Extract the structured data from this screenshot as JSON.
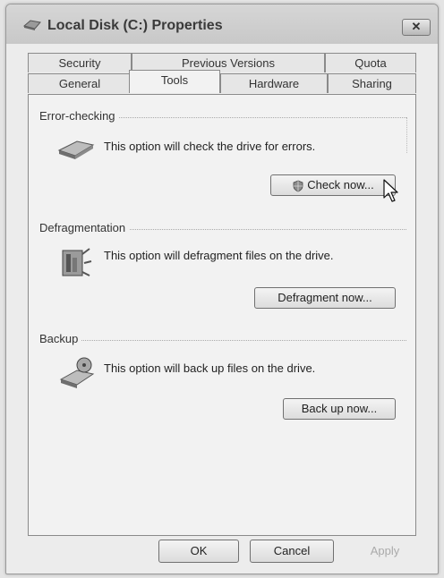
{
  "window": {
    "title": "Local Disk (C:) Properties",
    "close_label": "✕"
  },
  "tabs": {
    "row1": [
      {
        "label": "Security"
      },
      {
        "label": "Previous Versions"
      },
      {
        "label": "Quota"
      }
    ],
    "row2": [
      {
        "label": "General"
      },
      {
        "label": "Tools"
      },
      {
        "label": "Hardware"
      },
      {
        "label": "Sharing"
      }
    ],
    "active": "Tools"
  },
  "sections": {
    "error_checking": {
      "title": "Error-checking",
      "description": "This option will check the drive for errors.",
      "button": "Check now..."
    },
    "defragmentation": {
      "title": "Defragmentation",
      "description": "This option will defragment files on the drive.",
      "button": "Defragment now..."
    },
    "backup": {
      "title": "Backup",
      "description": "This option will back up files on the drive.",
      "button": "Back up now..."
    }
  },
  "footer": {
    "ok": "OK",
    "cancel": "Cancel",
    "apply": "Apply"
  },
  "icons": {
    "title": "drive-icon",
    "error_checking": "disk-check-icon",
    "defragmentation": "defragment-icon",
    "backup": "backup-icon",
    "check_button": "uac-shield-icon",
    "cursor": "mouse-pointer-icon"
  }
}
